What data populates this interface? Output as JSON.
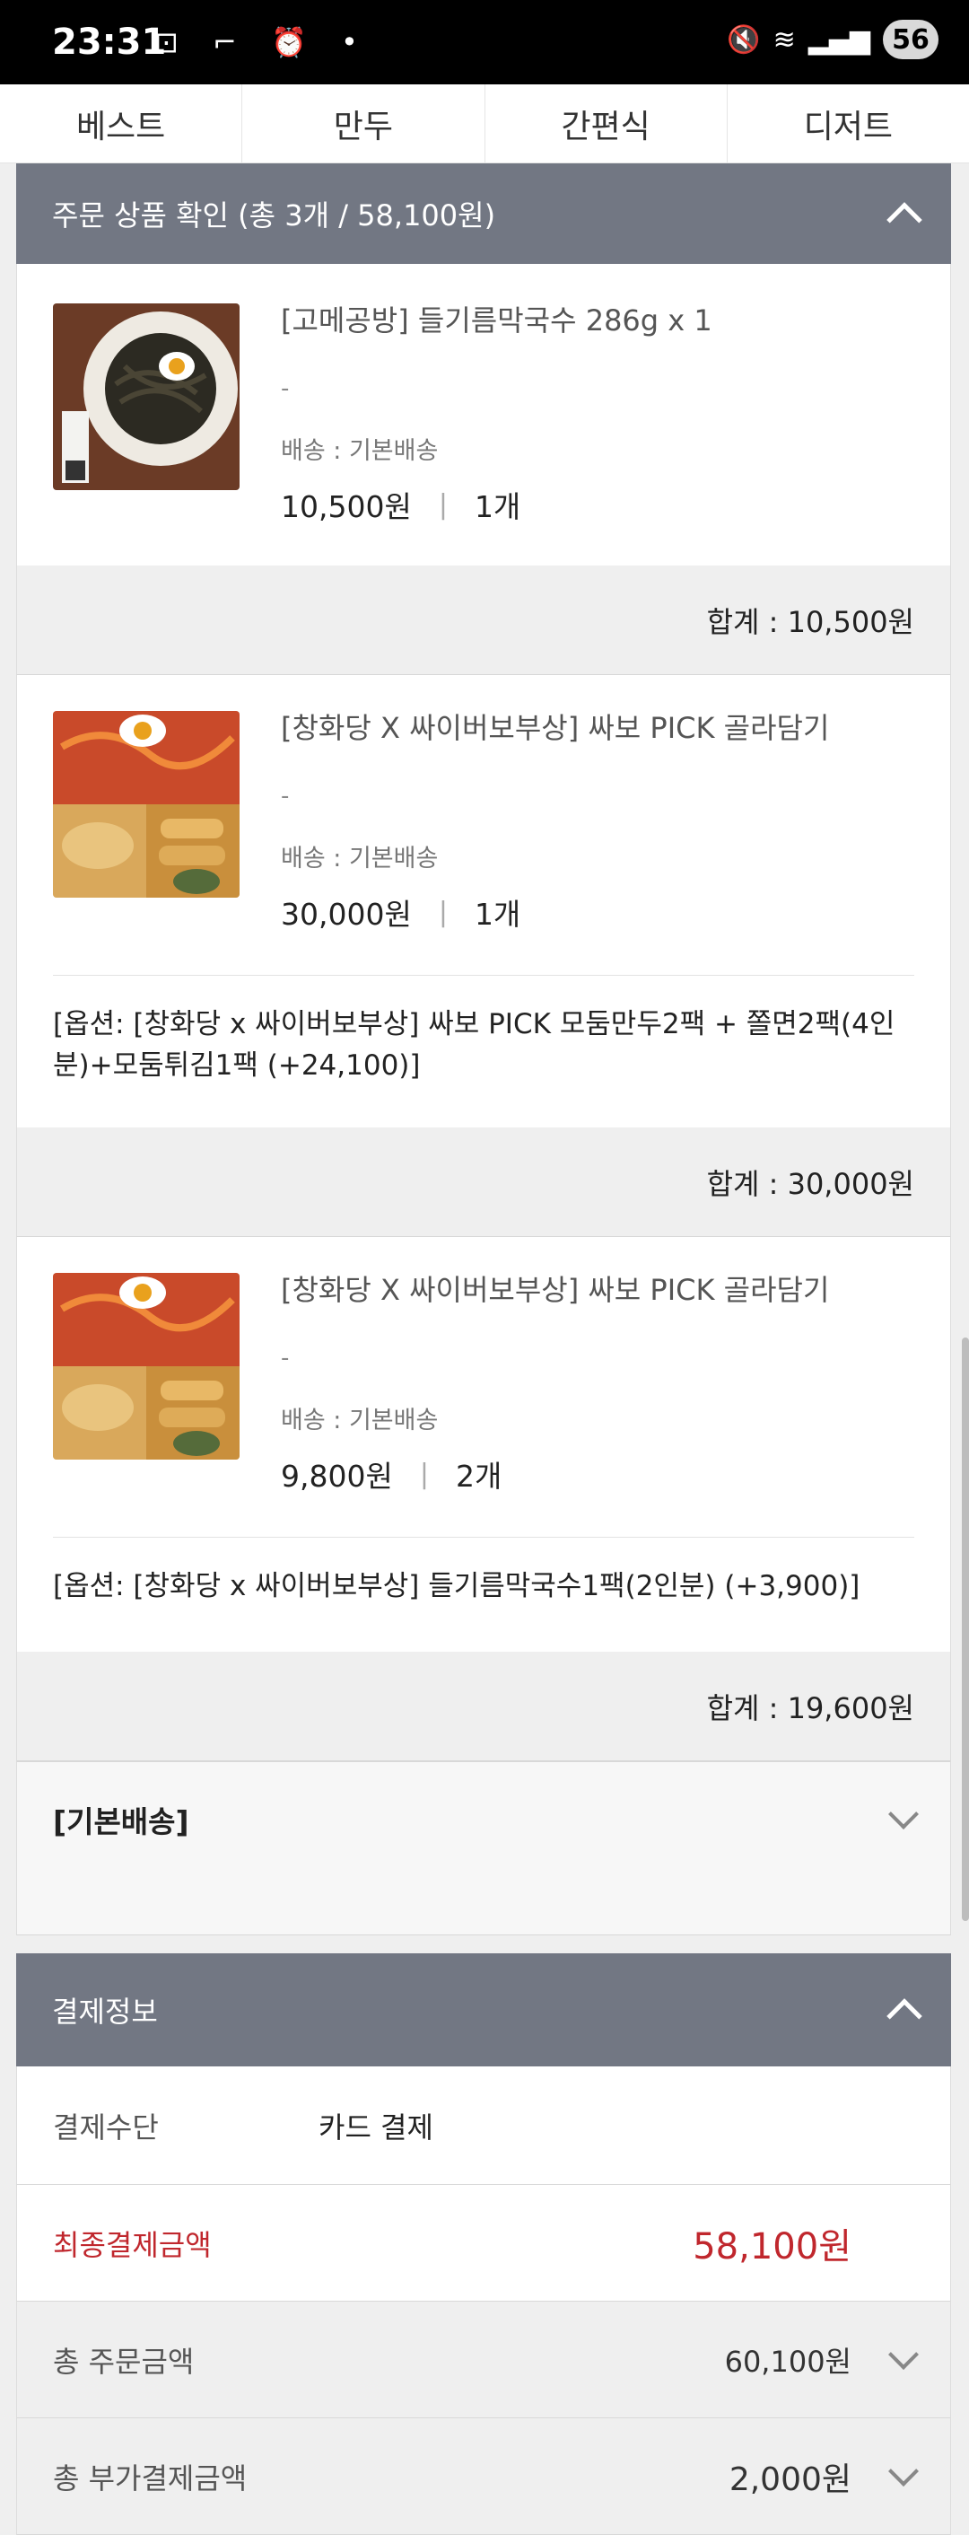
{
  "status_bar": {
    "time": "23:31",
    "battery": "56"
  },
  "tabs": [
    "베스트",
    "만두",
    "간편식",
    "디저트"
  ],
  "order_section": {
    "title": "주문 상품 확인 (총 3개 / 58,100원)"
  },
  "items": [
    {
      "name": "[고메공방] 들기름막국수 286g x 1",
      "dash": "-",
      "shipping": "배송 : 기본배송",
      "price": "10,500원",
      "separator": "|",
      "qty": "1개",
      "subtotal": "합계 : 10,500원"
    },
    {
      "name": "[창화당 X 싸이버보부상] 싸보 PICK 골라담기",
      "dash": "-",
      "shipping": "배송 : 기본배송",
      "price": "30,000원",
      "separator": "|",
      "qty": "1개",
      "option": "[옵션: [창화당 x 싸이버보부상] 싸보 PICK 모둠만두2팩 + 쫄면2팩(4인분)+모둠튀김1팩 (+24,100)]",
      "subtotal": "합계 : 30,000원"
    },
    {
      "name": "[창화당 X 싸이버보부상] 싸보 PICK 골라담기",
      "dash": "-",
      "shipping": "배송 : 기본배송",
      "price": "9,800원",
      "separator": "|",
      "qty": "2개",
      "option": "[옵션: [창화당 x 싸이버보부상] 들기름막국수1팩(2인분) (+3,900)]",
      "subtotal": "합계 : 19,600원"
    }
  ],
  "delivery": {
    "label": "[기본배송]"
  },
  "payment_section": {
    "title": "결제정보",
    "method_label": "결제수단",
    "method_value": "카드 결제",
    "final_label": "최종결제금액",
    "final_value": "58,100원",
    "order_total_label": "총 주문금액",
    "order_total_value": "60,100원",
    "extra_label": "총 부가결제금액",
    "extra_value": "2,000원"
  },
  "colors": {
    "accent_red": "#c0272d",
    "header_gray": "#727783"
  }
}
